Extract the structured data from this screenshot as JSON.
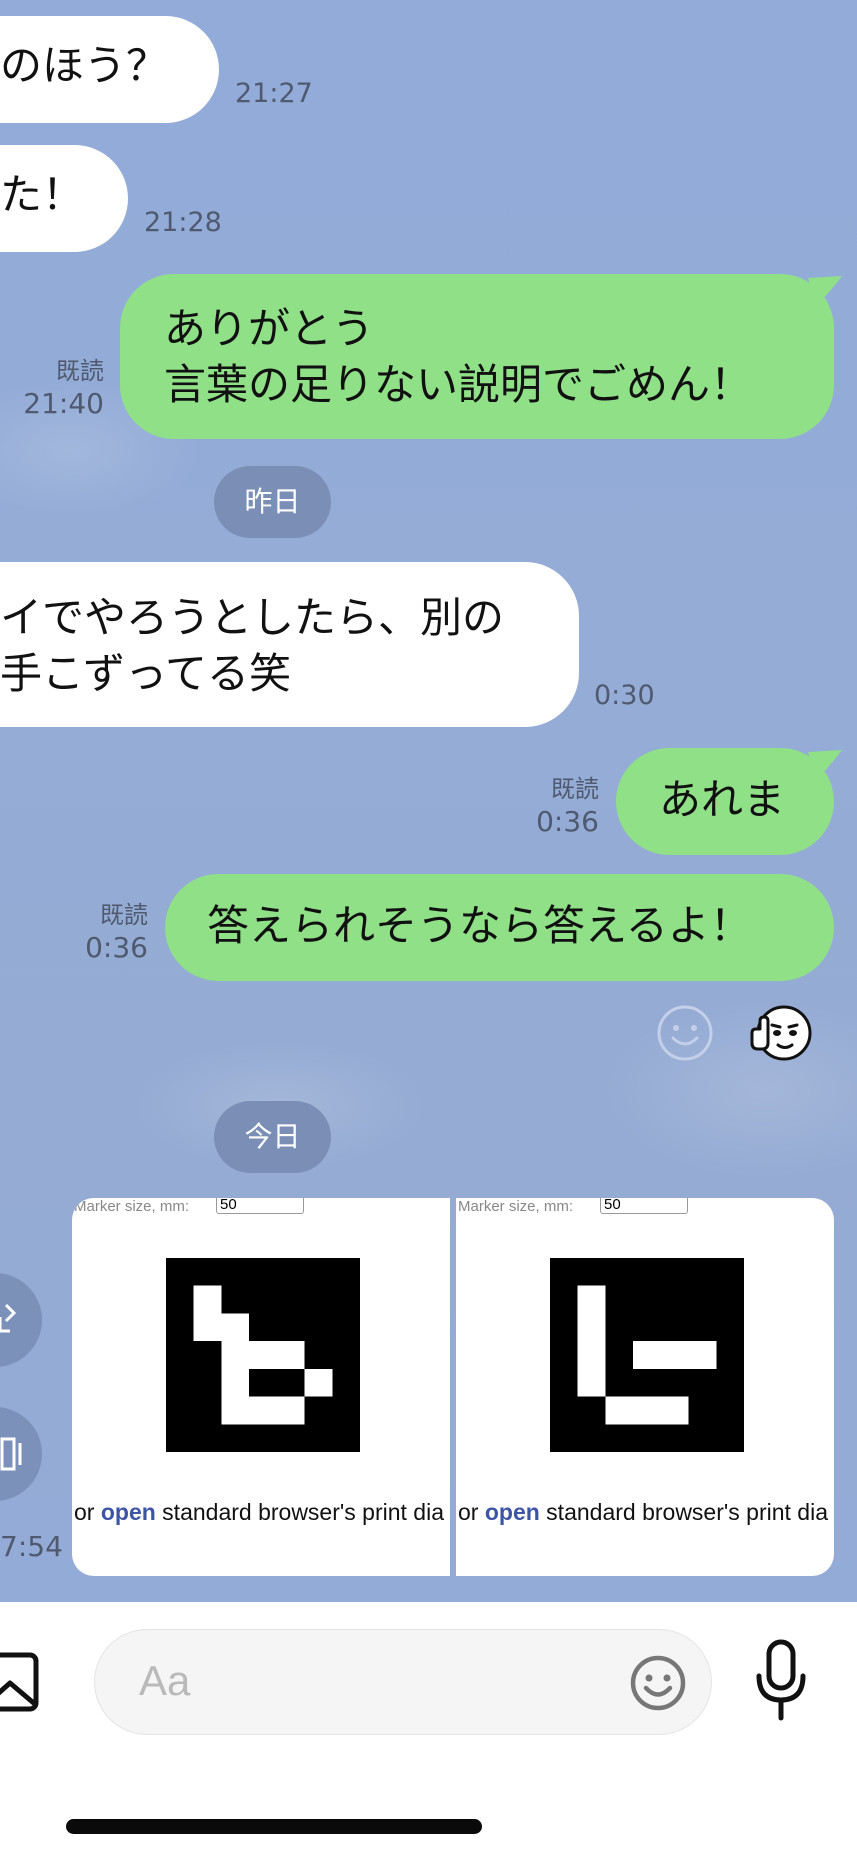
{
  "messages": {
    "m1": {
      "text": "のほう？",
      "time": "21:27"
    },
    "m2": {
      "text": "た！",
      "time": "21:28"
    },
    "m3": {
      "line1": "ありがとう",
      "line2": "言葉の足りない説明でごめん！",
      "read": "既読",
      "time": "21:40"
    },
    "m4": {
      "line1": "イでやろうとしたら、別の",
      "line2": "手こずってる笑",
      "time": "0:30"
    },
    "m5": {
      "text": "あれま",
      "read": "既読",
      "time": "0:36"
    },
    "m6": {
      "text": "答えられそうなら答えるよ！",
      "read": "既読",
      "time": "0:36"
    },
    "m7": {
      "time": "7:54"
    }
  },
  "dates": {
    "yesterday": "昨日",
    "today": "今日"
  },
  "cards": [
    {
      "marker_label": "Marker size, mm:",
      "marker_value": "50",
      "caption_before": "or ",
      "caption_link": "open",
      "caption_after": " standard browser's print dia"
    },
    {
      "marker_label": "Marker size, mm:",
      "marker_value": "50",
      "caption_before": "or ",
      "caption_link": "open",
      "caption_after": " standard browser's print dia"
    }
  ],
  "composer": {
    "placeholder": "Aa"
  },
  "icons": {
    "reaction": "smiley-outline-icon",
    "sticker": "thumbs-up-face-icon",
    "share": "share-icon",
    "save": "save-icon",
    "gallery": "image-icon",
    "emoji": "emoji-icon",
    "mic": "microphone-icon"
  },
  "colors": {
    "background": "#93abd6",
    "outgoing_bubble": "#8fe087",
    "incoming_bubble": "#ffffff",
    "date_pill": "#7b8fb6",
    "link": "#3c55a5"
  }
}
